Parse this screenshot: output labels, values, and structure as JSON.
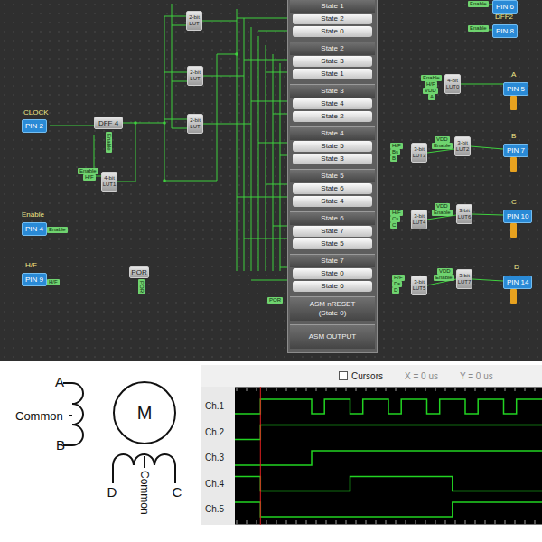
{
  "schematic": {
    "asm": {
      "states": [
        {
          "title": "State 1",
          "next": [
            "State 2",
            "State 0"
          ]
        },
        {
          "title": "State 2",
          "next": [
            "State 3",
            "State 1"
          ]
        },
        {
          "title": "State 3",
          "next": [
            "State 4",
            "State 2"
          ]
        },
        {
          "title": "State 4",
          "next": [
            "State 5",
            "State 3"
          ]
        },
        {
          "title": "State 5",
          "next": [
            "State 6",
            "State 4"
          ]
        },
        {
          "title": "State 6",
          "next": [
            "State 7",
            "State 5"
          ]
        },
        {
          "title": "State 7",
          "next": [
            "State 0",
            "State 6"
          ]
        }
      ],
      "reset": {
        "title": "ASM nRESET",
        "subtitle": "(State 0)"
      },
      "output": "ASM OUTPUT"
    },
    "pins": [
      "PIN 2",
      "PIN 4",
      "PIN 9",
      "PIN 6",
      "PIN 8",
      "PIN 5",
      "PIN 7",
      "PIN 10",
      "PIN 14"
    ],
    "captions": [
      "CLOCK",
      "Enable",
      "H/F",
      "DFF2",
      "A",
      "B",
      "C",
      "D"
    ],
    "blocks": [
      {
        "lines": [
          "DFF 4"
        ]
      },
      {
        "lines": [
          "4-bit",
          "LUT1"
        ]
      },
      {
        "lines": [
          "2-bit",
          "LUT"
        ]
      },
      {
        "lines": [
          "2-bit",
          "LUT"
        ]
      },
      {
        "lines": [
          "2-bit",
          "LUT"
        ]
      },
      {
        "lines": [
          "POR"
        ]
      },
      {
        "lines": [
          "4-bit",
          "LUT0"
        ]
      },
      {
        "lines": [
          "3-bit",
          "LUT3"
        ]
      },
      {
        "lines": [
          "3-bit",
          "LUT2"
        ]
      },
      {
        "lines": [
          "3-bit",
          "LUT4"
        ]
      },
      {
        "lines": [
          "3-bit",
          "LUT6"
        ]
      },
      {
        "lines": [
          "3-bit",
          "LUT5"
        ]
      },
      {
        "lines": [
          "3-bit",
          "LUT7"
        ]
      }
    ],
    "tags": [
      "Enable",
      "H/F",
      "Enable",
      "Enable",
      "H/F",
      "POR",
      "POR",
      "Enable",
      "Enable",
      "Enable",
      "H/F",
      "VDD",
      "A",
      "H/F",
      "Bs",
      "B",
      "VDD",
      "Enable",
      "H/F",
      "Cs",
      "C",
      "VDD",
      "Enable",
      "H/F",
      "Ds",
      "D",
      "VDD",
      "Enable"
    ]
  },
  "motor": {
    "labels": [
      "A",
      "Common",
      "B",
      "M",
      "D",
      "Common",
      "C"
    ]
  },
  "analyzer": {
    "cursors": {
      "label": "Cursors",
      "checked": false
    },
    "x_readout": "X = 0 us",
    "y_readout": "Y = 0 us",
    "cursor": 2,
    "channels": [
      {
        "name": "Ch.1",
        "values": [
          0,
          0,
          1,
          1,
          1,
          1,
          0,
          1,
          1,
          0,
          1,
          1,
          0,
          1,
          1,
          0,
          1,
          1,
          0,
          1,
          1,
          0,
          1,
          1
        ]
      },
      {
        "name": "Ch.2",
        "values": [
          0,
          0,
          1,
          1,
          1,
          1,
          1,
          1,
          1,
          1,
          1,
          1,
          1,
          1,
          1,
          1,
          1,
          1,
          1,
          1,
          1,
          1,
          1,
          1
        ]
      },
      {
        "name": "Ch.3",
        "values": [
          0,
          0,
          0,
          0,
          0,
          0,
          1,
          1,
          1,
          1,
          1,
          1,
          1,
          1,
          1,
          1,
          1,
          1,
          1,
          1,
          1,
          1,
          1,
          1
        ]
      },
      {
        "name": "Ch.4",
        "values": [
          1,
          1,
          0,
          0,
          0,
          0,
          0,
          0,
          0,
          1,
          1,
          1,
          1,
          1,
          1,
          1,
          1,
          0,
          0,
          0,
          0,
          0,
          0,
          0
        ]
      },
      {
        "name": "Ch.5",
        "values": [
          1,
          1,
          0,
          0,
          0,
          0,
          0,
          0,
          0,
          0,
          0,
          0,
          0,
          0,
          0,
          0,
          0,
          1,
          1,
          1,
          1,
          1,
          1,
          1
        ]
      }
    ]
  }
}
